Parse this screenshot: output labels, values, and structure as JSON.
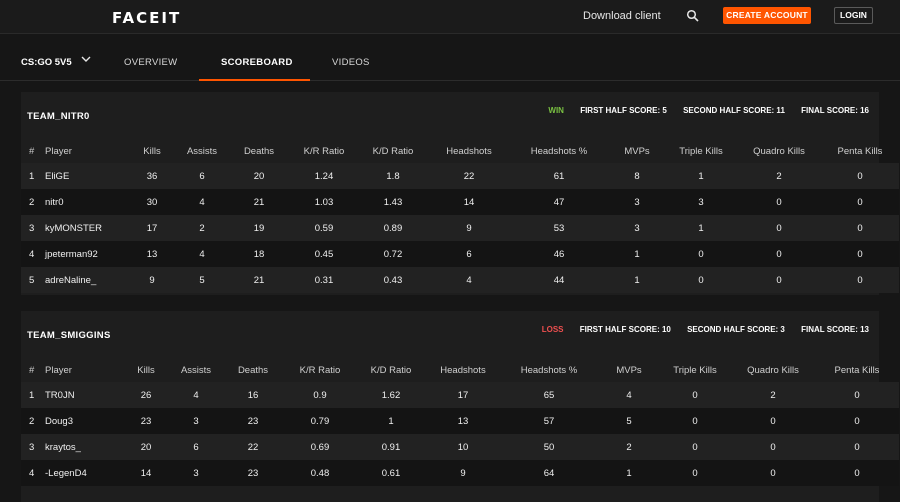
{
  "header": {
    "logo": "FACEIT",
    "download_client": "Download client",
    "create_account": "CREATE ACCOUNT",
    "login": "LOGIN"
  },
  "nav": {
    "game": "CS:GO 5V5",
    "tabs": [
      {
        "label": "OVERVIEW",
        "active": false
      },
      {
        "label": "SCOREBOARD",
        "active": true
      },
      {
        "label": "VIDEOS",
        "active": false
      }
    ]
  },
  "columns": [
    "#",
    "Player",
    "Kills",
    "Assists",
    "Deaths",
    "K/R Ratio",
    "K/D Ratio",
    "Headshots",
    "Headshots %",
    "MVPs",
    "Triple Kills",
    "Quadro Kills",
    "Penta Kills"
  ],
  "teams": [
    {
      "name": "TEAM_NITR0",
      "result": "WIN",
      "first_half": "FIRST HALF SCORE: 5",
      "second_half": "SECOND HALF SCORE: 11",
      "final": "FINAL SCORE: 16",
      "players": [
        [
          "1",
          "EliGE",
          "36",
          "6",
          "20",
          "1.24",
          "1.8",
          "22",
          "61",
          "8",
          "1",
          "2",
          "0"
        ],
        [
          "2",
          "nitr0",
          "30",
          "4",
          "21",
          "1.03",
          "1.43",
          "14",
          "47",
          "3",
          "3",
          "0",
          "0"
        ],
        [
          "3",
          "kyMONSTER",
          "17",
          "2",
          "19",
          "0.59",
          "0.89",
          "9",
          "53",
          "3",
          "1",
          "0",
          "0"
        ],
        [
          "4",
          "jpeterman92",
          "13",
          "4",
          "18",
          "0.45",
          "0.72",
          "6",
          "46",
          "1",
          "0",
          "0",
          "0"
        ],
        [
          "5",
          "adreNaline_",
          "9",
          "5",
          "21",
          "0.31",
          "0.43",
          "4",
          "44",
          "1",
          "0",
          "0",
          "0"
        ]
      ]
    },
    {
      "name": "TEAM_SMIGGINS",
      "result": "LOSS",
      "first_half": "FIRST HALF SCORE: 10",
      "second_half": "SECOND HALF SCORE: 3",
      "final": "FINAL SCORE: 13",
      "players": [
        [
          "1",
          "TR0JN",
          "26",
          "4",
          "16",
          "0.9",
          "1.62",
          "17",
          "65",
          "4",
          "0",
          "2",
          "0"
        ],
        [
          "2",
          "Doug3",
          "23",
          "3",
          "23",
          "0.79",
          "1",
          "13",
          "57",
          "5",
          "0",
          "0",
          "0"
        ],
        [
          "3",
          "kraytos_",
          "20",
          "6",
          "22",
          "0.69",
          "0.91",
          "10",
          "50",
          "2",
          "0",
          "0",
          "0"
        ],
        [
          "4",
          "-LegenD4",
          "14",
          "3",
          "23",
          "0.48",
          "0.61",
          "9",
          "64",
          "1",
          "0",
          "0",
          "0"
        ]
      ]
    }
  ],
  "colors": {
    "accent": "#ff5500",
    "win": "#7ac142",
    "loss": "#ee4f4f"
  }
}
